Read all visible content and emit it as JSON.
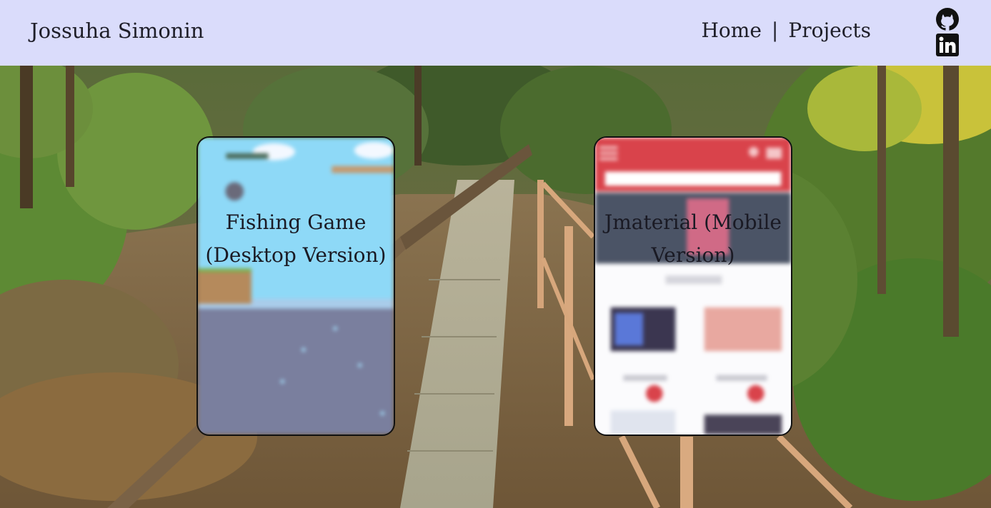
{
  "header": {
    "site_name": "Jossuha Simonin",
    "nav": {
      "home_label": "Home",
      "separator": "|",
      "projects_label": "Projects"
    },
    "social_icons": [
      "github-icon",
      "linkedin-icon"
    ]
  },
  "projects": [
    {
      "title_line1": "Fishing Game",
      "title_line2": "(Desktop Version)"
    },
    {
      "title_line1": "Jmaterial (Mobile",
      "title_line2": "Version)"
    }
  ],
  "colors": {
    "header_bg": "#dadcfb",
    "text": "#1e1e28",
    "jmaterial_brand": "#d9434b",
    "fishing_sky": "#8ed9f7",
    "fishing_water": "#7a7f9e"
  }
}
